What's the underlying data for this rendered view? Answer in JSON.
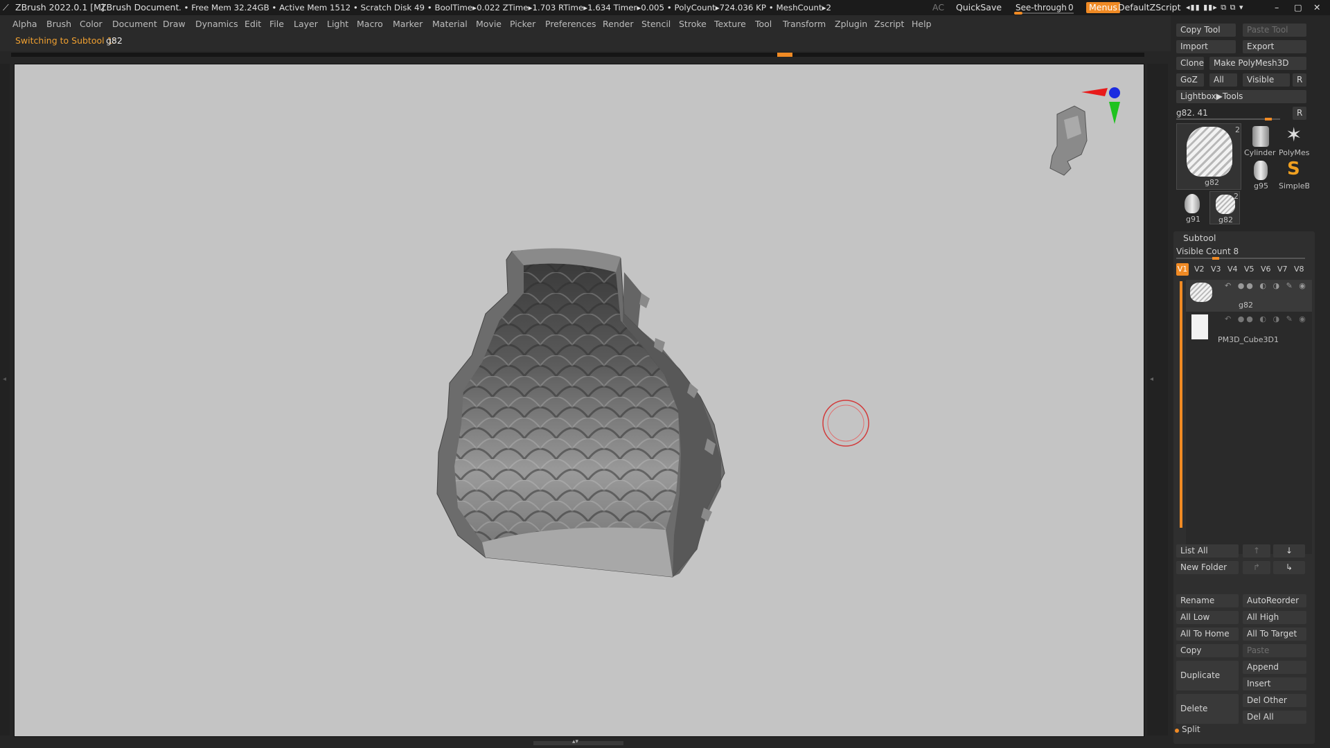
{
  "titlebar": {
    "app_title": "ZBrush 2022.0.1 [M]",
    "document": "ZBrush Document",
    "stats": ". • Free Mem 32.24GB • Active Mem 1512 • Scratch Disk 49 •  BoolTime▸0.022 ZTime▸1.703 RTime▸1.634 Timer▸0.005 • PolyCount▸724.036 KP  • MeshCount▸2",
    "ac": "AC",
    "quicksave": "QuickSave",
    "seethrough_label": "See-through",
    "seethrough_value": "0",
    "menus_label": "Menus",
    "default_zscript": "DefaultZScript"
  },
  "menubar": [
    "Alpha",
    "Brush",
    "Color",
    "Document",
    "Draw",
    "Dynamics",
    "Edit",
    "File",
    "Layer",
    "Light",
    "Macro",
    "Marker",
    "Material",
    "Movie",
    "Picker",
    "Preferences",
    "Render",
    "Stencil",
    "Stroke",
    "Texture",
    "Tool",
    "Transform",
    "Zplugin",
    "Zscript",
    "Help"
  ],
  "notebar": {
    "message": "Switching to Subtool 1:",
    "subtool": "g82"
  },
  "colors": {
    "accent": "#f08a24",
    "viewport_bg": "#c4c4c4",
    "panel_bg": "#262626",
    "button_bg": "#393939"
  },
  "tool_panel": {
    "copy_tool": "Copy Tool",
    "paste_tool": "Paste Tool",
    "import": "Import",
    "export": "Export",
    "clone": "Clone",
    "make_polymesh": "Make PolyMesh3D",
    "goz": "GoZ",
    "all": "All",
    "visible": "Visible",
    "r": "R",
    "lightbox_tools": "Lightbox▶Tools",
    "current_tool": "g82. 41",
    "r2": "R",
    "thumbs": {
      "main": {
        "label": "g82",
        "count": "2"
      },
      "cylinder": "Cylinder",
      "polymesh": "PolyMes",
      "g95": "g95",
      "simpleb": "SimpleB",
      "g91": "g91",
      "g82b": {
        "label": "g82",
        "count": "2"
      }
    }
  },
  "subtool": {
    "title": "Subtool",
    "visible_count": "Visible Count 8",
    "tabs": [
      "V1",
      "V2",
      "V3",
      "V4",
      "V5",
      "V6",
      "V7",
      "V8"
    ],
    "items": [
      {
        "name": "g82"
      },
      {
        "name": "PM3D_Cube3D1"
      }
    ],
    "list_all": "List All",
    "new_folder": "New Folder",
    "rename": "Rename",
    "autoreorder": "AutoReorder",
    "all_low": "All Low",
    "all_high": "All High",
    "all_to_home": "All To Home",
    "all_to_target": "All To Target",
    "copy": "Copy",
    "paste": "Paste",
    "duplicate": "Duplicate",
    "append": "Append",
    "insert": "Insert",
    "delete": "Delete",
    "del_other": "Del Other",
    "del_all": "Del All",
    "split": "Split"
  }
}
